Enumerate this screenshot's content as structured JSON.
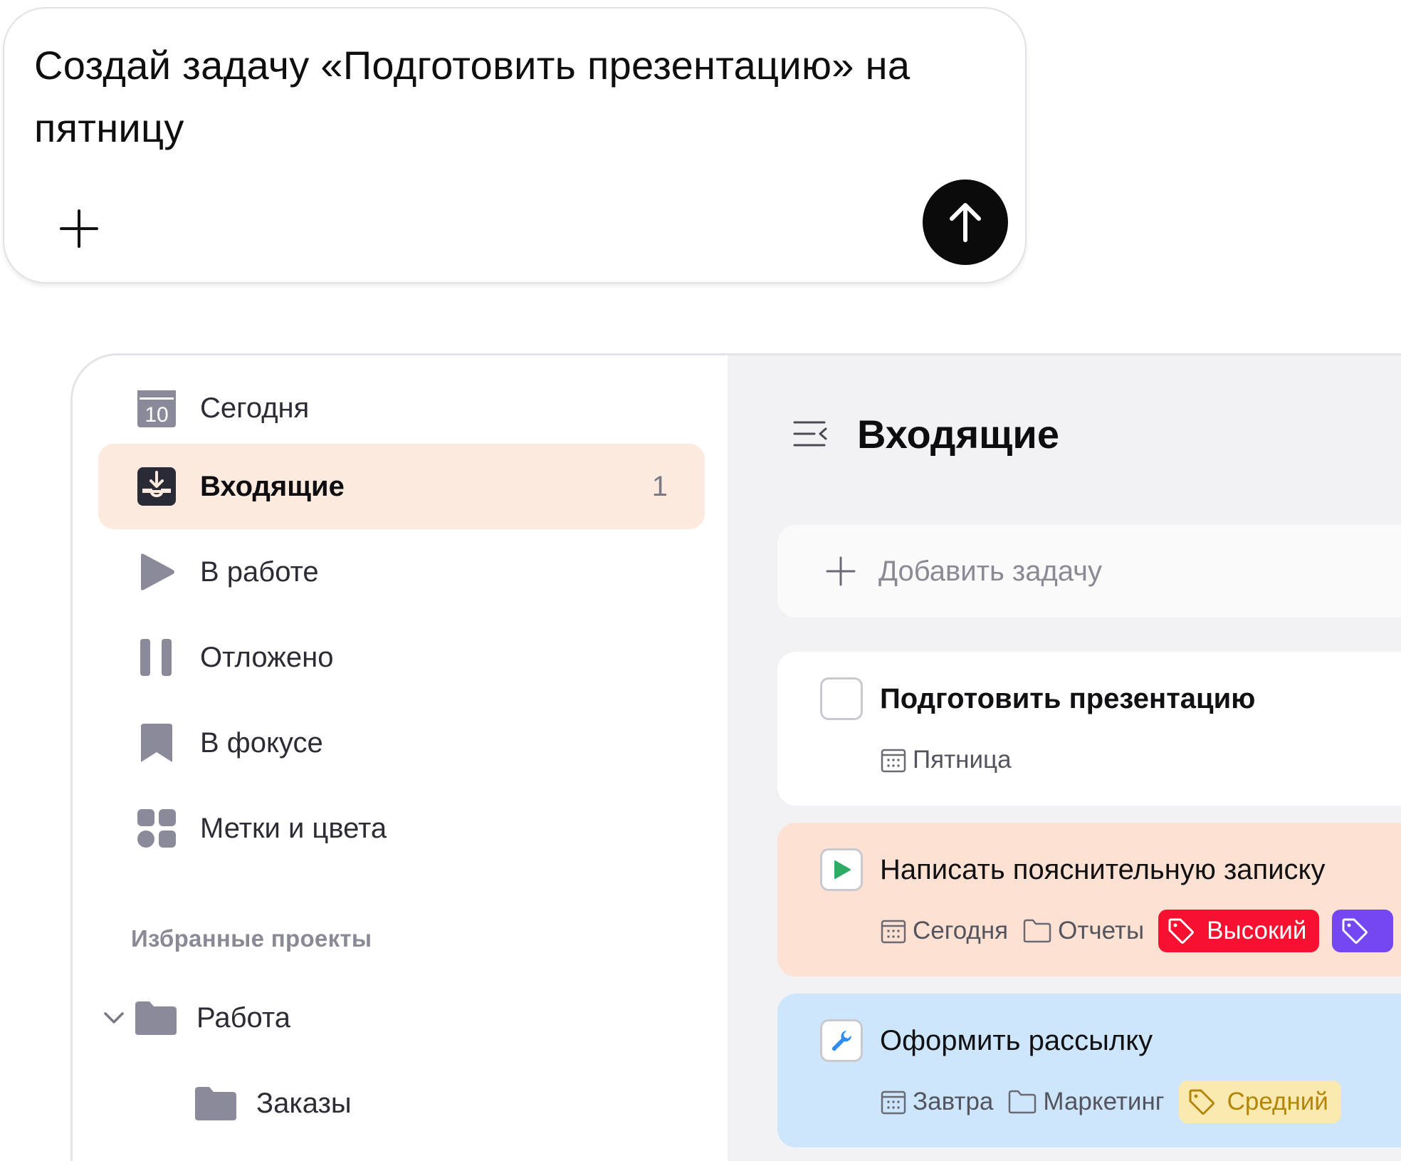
{
  "prompt": {
    "text": "Создай задачу «Подготовить презентацию» на пятницу",
    "attach_icon": "plus-icon",
    "send_icon": "arrow-up-icon"
  },
  "sidebar": {
    "items": [
      {
        "label": "Сегодня",
        "icon": "calendar-10-icon",
        "count": ""
      },
      {
        "label": "Входящие",
        "icon": "inbox-icon",
        "count": "1",
        "active": true
      },
      {
        "label": "В работе",
        "icon": "play-icon",
        "count": ""
      },
      {
        "label": "Отложено",
        "icon": "pause-icon",
        "count": ""
      },
      {
        "label": "В фокусе",
        "icon": "bookmark-icon",
        "count": ""
      },
      {
        "label": "Метки и цвета",
        "icon": "tags-grid-icon",
        "count": ""
      }
    ],
    "today_date": "10",
    "favorites_title": "Избранные проекты",
    "projects": [
      {
        "label": "Работа",
        "icon": "folder-icon",
        "expanded": true
      },
      {
        "label": "Заказы",
        "icon": "folder-icon"
      }
    ]
  },
  "main": {
    "title": "Входящие",
    "add_task_placeholder": "Добавить задачу",
    "tasks": [
      {
        "title": "Подготовить презентацию",
        "status": "new",
        "date": "Пятница",
        "project": "",
        "tags": []
      },
      {
        "title": "Написать пояснительную записку",
        "status": "in-progress",
        "date": "Сегодня",
        "project": "Отчеты",
        "tags": [
          {
            "label": "Высокий",
            "color": "#f5112f"
          },
          {
            "label": "",
            "color": "#7447f0"
          }
        ]
      },
      {
        "title": "Оформить рассылку",
        "status": "tool",
        "date": "Завтра",
        "project": "Маркетинг",
        "tags": [
          {
            "label": "Средний",
            "color": "#fbeab0"
          }
        ]
      }
    ]
  },
  "colors": {
    "active_bg": "#fdeadf",
    "sidebar_icon": "#8a8a9a",
    "main_bg": "#f2f2f5",
    "peach_card": "#fde2d3",
    "blue_card": "#cde6fb",
    "play_green": "#2eab64",
    "wrench_blue": "#2f8cf0"
  }
}
